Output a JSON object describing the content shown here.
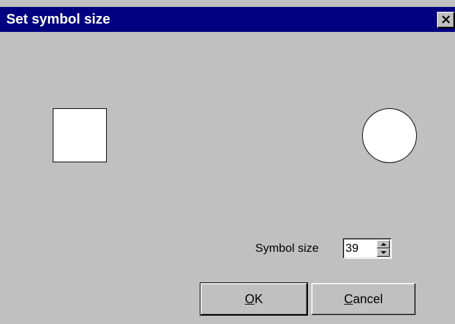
{
  "window": {
    "title": "Set symbol size",
    "close_icon": "close-icon"
  },
  "preview": {
    "square_symbol": "square-symbol",
    "circle_symbol": "circle-symbol"
  },
  "symbol_size": {
    "label": "Symbol size",
    "value": "39"
  },
  "buttons": {
    "ok_mnemonic": "O",
    "ok_rest": "K",
    "cancel_mnemonic": "C",
    "cancel_rest": "ancel"
  },
  "colors": {
    "titlebar": "#000080",
    "dialog_face": "#c0c0c0",
    "title_text": "#ffffff"
  }
}
